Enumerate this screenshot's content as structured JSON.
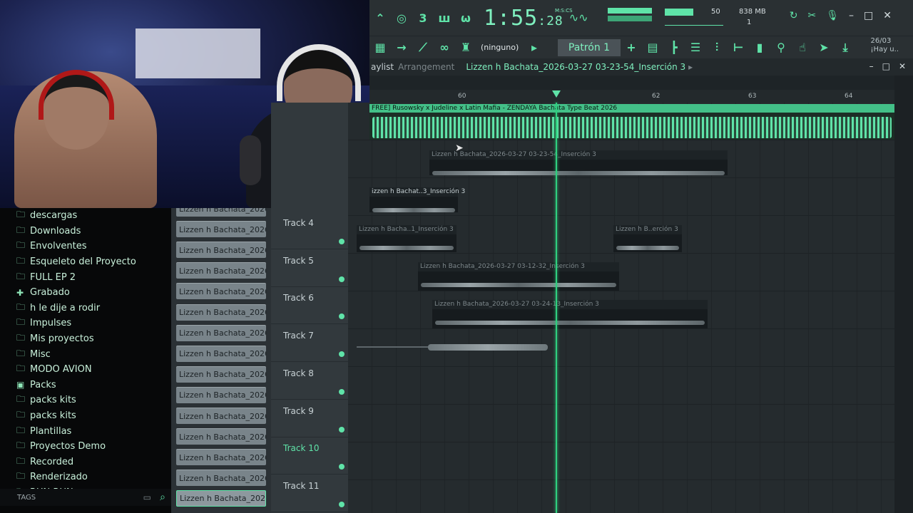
{
  "transport": {
    "time": "1:55",
    "time_frac": ":28",
    "mscs_label": "M:S:CS",
    "cpu_value": "50",
    "memory": "838 MB",
    "polyphony": "1"
  },
  "toolbar2": {
    "pattern_selector": "(ninguno)",
    "pattern": "Patrón 1",
    "hint_date": "26/03",
    "hint_text": "¡Hay u.."
  },
  "playlist": {
    "title": "aylist",
    "subtitle": "Arrangement",
    "pattern_name": "Lizzen h Bachata_2026-03-27 03-23-54_Inserción 3",
    "ruler_marks": [
      "60",
      "62",
      "63",
      "64"
    ]
  },
  "browser": {
    "folders": [
      {
        "label": "descargas",
        "icon": "folder-icon"
      },
      {
        "label": "Downloads",
        "icon": "folder-icon"
      },
      {
        "label": "Envolventes",
        "icon": "folder-icon"
      },
      {
        "label": "Esqueleto del Proyecto",
        "icon": "folder-icon"
      },
      {
        "label": "FULL EP 2",
        "icon": "folder-icon"
      },
      {
        "label": "Grabado",
        "icon": "recorded-icon"
      },
      {
        "label": "h le dije a rodir",
        "icon": "folder-icon"
      },
      {
        "label": "Impulses",
        "icon": "folder-icon"
      },
      {
        "label": "Mis proyectos",
        "icon": "folder-icon"
      },
      {
        "label": "Misc",
        "icon": "folder-icon"
      },
      {
        "label": "MODO AVION",
        "icon": "folder-icon"
      },
      {
        "label": "Packs",
        "icon": "packs-icon"
      },
      {
        "label": "packs kits",
        "icon": "folder-icon"
      },
      {
        "label": "packs kits",
        "icon": "folder-icon"
      },
      {
        "label": "Plantillas",
        "icon": "folder-icon"
      },
      {
        "label": "Proyectos Demo",
        "icon": "folder-icon"
      },
      {
        "label": "Recorded",
        "icon": "folder-icon"
      },
      {
        "label": "Renderizado",
        "icon": "folder-icon"
      },
      {
        "label": "RUN RUN",
        "icon": "folder-icon"
      }
    ],
    "tags_label": "TAGS"
  },
  "picker": {
    "items": [
      "Lizzen h Bachata_2026-0...",
      "Lizzen h Bachata_2026-0...",
      "Lizzen h Bachata_2026-0...",
      "Lizzen h Bachata_2026-0...",
      "Lizzen h Bachata_2026-0...",
      "Lizzen h Bachata_2026-0...",
      "Lizzen h Bachata_2026-0...",
      "Lizzen h Bachata_2026-0...",
      "Lizzen h Bachata_2026-0...",
      "Lizzen h Bachata_2026-0...",
      "Lizzen h Bachata_2026-0...",
      "Lizzen h Bachata_2026-0...",
      "Lizzen h Bachata_2026-0...",
      "Lizzen h Bachata_2026-0...",
      "Lizzen h Bachata_2026-0..."
    ]
  },
  "tracks": [
    {
      "name": "Track 4",
      "highlight": false
    },
    {
      "name": "Track 5",
      "highlight": false
    },
    {
      "name": "Track 6",
      "highlight": false
    },
    {
      "name": "Track 7",
      "highlight": false
    },
    {
      "name": "Track 8",
      "highlight": false
    },
    {
      "name": "Track 9",
      "highlight": false
    },
    {
      "name": "Track 10",
      "highlight": true
    },
    {
      "name": "Track 11",
      "highlight": false
    }
  ],
  "clips": {
    "beat": "FREE] Rusowsky x Judeline x Latin Mafia - ZENDAYA  Bachata Type Beat 2026",
    "c1": "Lizzen h Bachata_2026-03-27 03-23-54_Inserción 3",
    "c2": "izzen h Bachat..3_Inserción 3",
    "c3": "Lizzen h Bacha..1_Inserción 3",
    "c4": "Lizzen h B..erción 3",
    "c5": "Lizzen h Bachata_2026-03-27 03-12-32_Inserción 3",
    "c6": "Lizzen h Bachata_2026-03-27 03-24-13_Inserción 3"
  },
  "colors": {
    "accent": "#5fe3a8",
    "playhead": "#2fd07f",
    "panel": "#2a3033"
  }
}
